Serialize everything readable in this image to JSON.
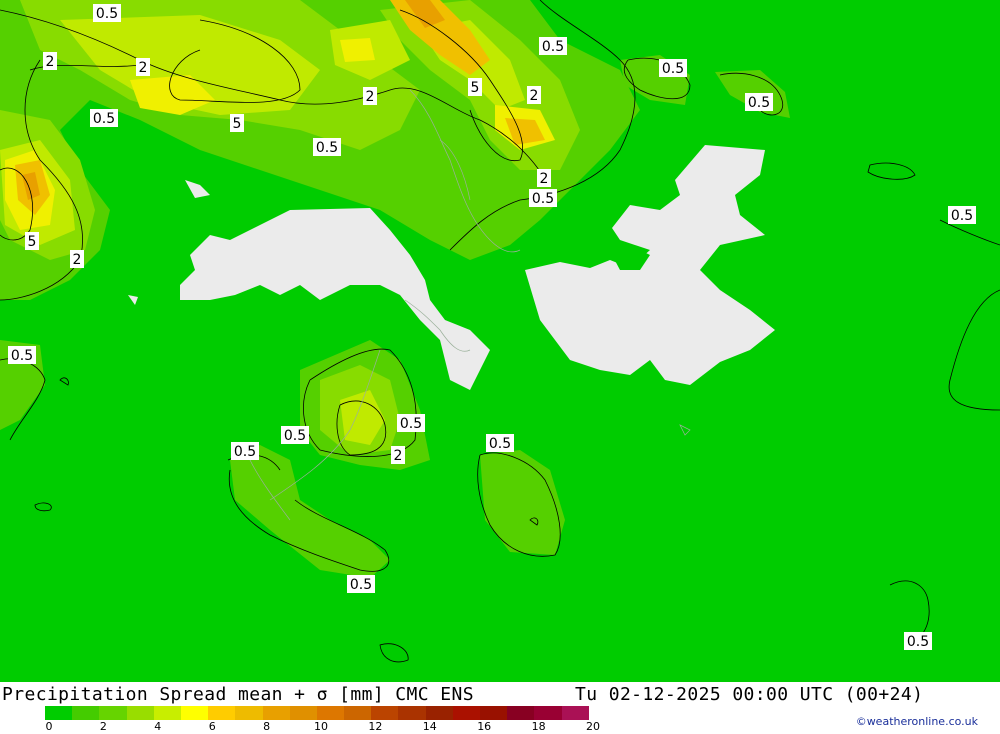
{
  "title": "Precipitation Spread mean + σ [mm] CMC ENS",
  "datetime": "Tu 02-12-2025 00:00 UTC (00+24)",
  "credit": "©weatheronline.co.uk",
  "colors": {
    "base": "#00cc00",
    "no_data": "#ebebeb",
    "levels": [
      "#00cc00",
      "#44cc00",
      "#66d400",
      "#99dd00",
      "#c8ee00",
      "#ffff00",
      "#ffcc00",
      "#eebb00",
      "#e8a000",
      "#e09000",
      "#dd7700",
      "#cc6600",
      "#bb4400",
      "#aa3300",
      "#992200",
      "#aa1100",
      "#991100",
      "#880022",
      "#990033",
      "#aa1155"
    ]
  },
  "legend": {
    "ticks": [
      "0",
      "2",
      "4",
      "6",
      "8",
      "10",
      "12",
      "14",
      "16",
      "18",
      "20"
    ]
  },
  "contour_labels": [
    {
      "text": "0.5"
    },
    {
      "text": "2"
    },
    {
      "text": "2"
    },
    {
      "text": "0.5"
    },
    {
      "text": "0.5"
    },
    {
      "text": "0.5"
    },
    {
      "text": "2"
    },
    {
      "text": "5"
    },
    {
      "text": "5"
    },
    {
      "text": "2"
    },
    {
      "text": "0.5"
    },
    {
      "text": "0.5"
    },
    {
      "text": "0.5"
    },
    {
      "text": "2"
    },
    {
      "text": "0.5"
    },
    {
      "text": "5"
    },
    {
      "text": "2"
    },
    {
      "text": "0.5"
    },
    {
      "text": "0.5"
    },
    {
      "text": "0.5"
    },
    {
      "text": "2"
    },
    {
      "text": "0.5"
    },
    {
      "text": "0.5"
    },
    {
      "text": "0.5"
    },
    {
      "text": "0.5"
    }
  ]
}
